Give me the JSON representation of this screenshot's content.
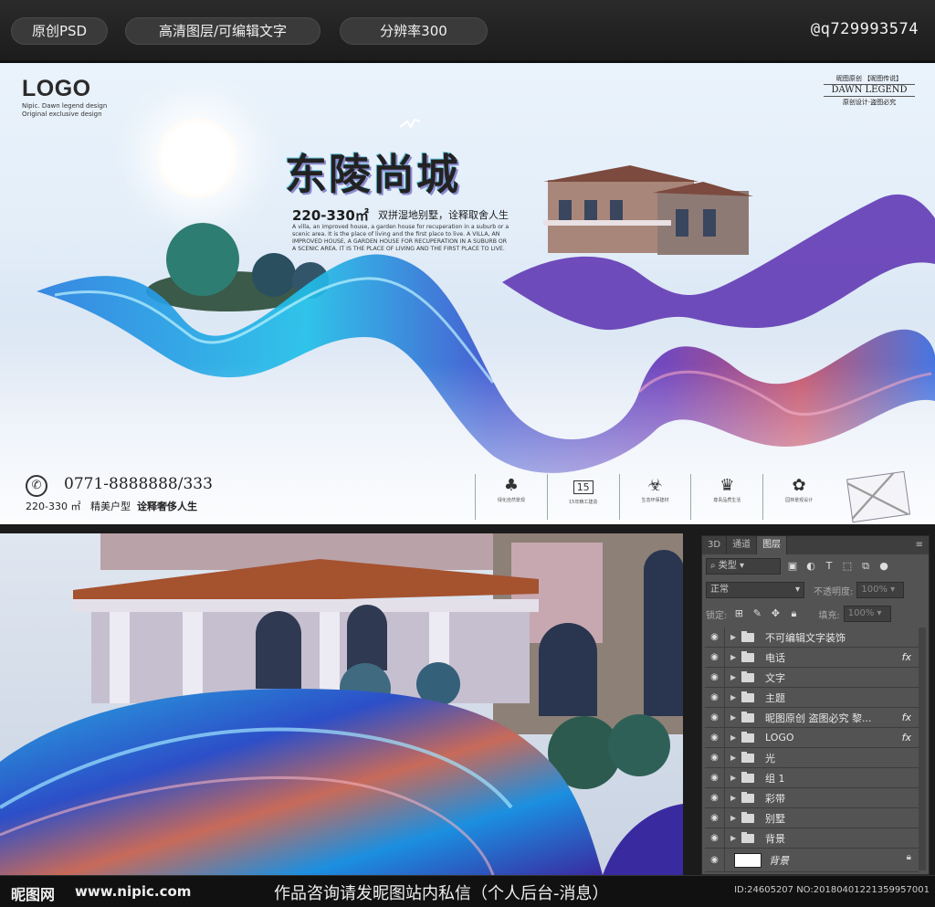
{
  "top_bar": {
    "pills": [
      "原创PSD",
      "高清图层/可编辑文字",
      "分辨率300"
    ],
    "handle": "@q729993574"
  },
  "poster": {
    "logo": "LOGO",
    "logo_sub": [
      "Nipic. Dawn legend design",
      "Original exclusive design"
    ],
    "title": "东陵尚城",
    "area": "220-330㎡",
    "area_tag": "双拼湿地别墅，诠释取舍人生",
    "description": "A villa, an improved house, a garden house for recuperation in a suburb or a scenic area. It is the place of living and the first place to live. A VILLA, AN IMPROVED HOUSE, A GARDEN HOUSE FOR RECUPERATION IN A SUBURB OR A SCENIC AREA. IT IS THE PLACE OF LIVING AND THE FIRST PLACE TO LIVE.",
    "brand": {
      "top": "昵图原创 【昵图传说】",
      "main": "DAWN LEGEND",
      "bottom": "原创设计·盗图必究"
    },
    "phone": "0771-8888888/333",
    "bottom_line": {
      "area": "220-330 ㎡",
      "type": "精美户型",
      "slogan": "诠释奢侈人生"
    },
    "features": [
      {
        "icon": "tree-icon",
        "glyph": "♣",
        "caption": "绿化自然景观"
      },
      {
        "icon": "badge-15-icon",
        "glyph": "15",
        "caption": "15年精工建造"
      },
      {
        "icon": "biohazard-icon",
        "glyph": "☣",
        "caption": "生态环保建材"
      },
      {
        "icon": "crown-icon",
        "glyph": "♛",
        "caption": "尊贵品质生活"
      },
      {
        "icon": "flower-icon",
        "glyph": "✿",
        "caption": "园林景观设计"
      }
    ]
  },
  "panel": {
    "tabs": [
      "3D",
      "通道",
      "图层"
    ],
    "active_tab": "图层",
    "filter_label": "类型",
    "blend_mode": "正常",
    "opacity_label": "不透明度:",
    "opacity_value": "100%",
    "lock_label": "锁定:",
    "fill_label": "填充:",
    "fill_value": "100%",
    "layers": [
      {
        "name": "不可编辑文字装饰",
        "fx": ""
      },
      {
        "name": "电话",
        "fx": "fx"
      },
      {
        "name": "文字",
        "fx": ""
      },
      {
        "name": "主题",
        "fx": ""
      },
      {
        "name": "昵图原创 盗图必究 黎...",
        "fx": "fx"
      },
      {
        "name": "LOGO",
        "fx": "fx"
      },
      {
        "name": "光",
        "fx": ""
      },
      {
        "name": "组 1",
        "fx": ""
      },
      {
        "name": "彩带",
        "fx": ""
      },
      {
        "name": "别墅",
        "fx": ""
      },
      {
        "name": "背景",
        "fx": ""
      }
    ],
    "background_layer": "背景"
  },
  "footer": {
    "logo": "昵图网",
    "url": "www.nipic.com",
    "message": "作品咨询请发昵图站内私信（个人后台-消息）",
    "id": "ID:24605207 NO:20180401221359957001"
  },
  "colors": {
    "ribbon_blue": "#1f6fd8",
    "ribbon_purple": "#6a3ab8",
    "panel_bg": "#535353"
  }
}
